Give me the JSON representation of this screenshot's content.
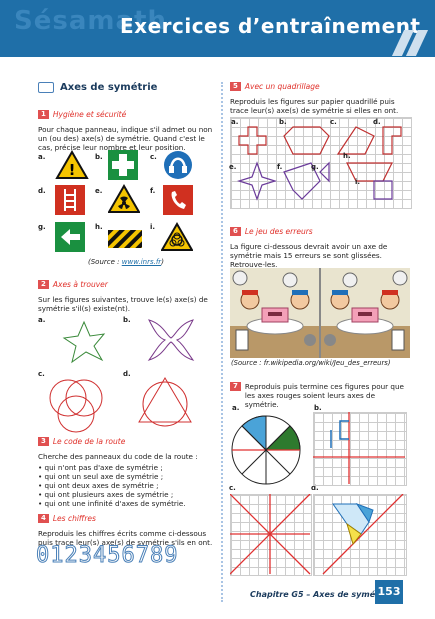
{
  "banner": {
    "ghost": "Sésamath",
    "title": "Exercices d’entraînement"
  },
  "section": {
    "title": "Axes de symétrie"
  },
  "ex1": {
    "num": "1",
    "title": "Hygiène et sécurité",
    "text": "Pour chaque panneau, indique s'il admet ou non un (ou des) axe(s) de symétrie. Quand c'est le cas, précise leur nombre et leur position.",
    "labels": [
      "a.",
      "b.",
      "c.",
      "d.",
      "e.",
      "f.",
      "g.",
      "h.",
      "i."
    ],
    "source_prefix": "(Source : ",
    "source_link": "www.inrs.fr",
    "source_suffix": ")"
  },
  "ex2": {
    "num": "2",
    "title": "Axes à trouver",
    "text": "Sur les figures suivantes, trouve le(s) axe(s) de symétrie s'il(s) existe(nt).",
    "labels": [
      "a.",
      "b.",
      "c.",
      "d."
    ]
  },
  "ex3": {
    "num": "3",
    "title": "Le code de la route",
    "intro": "Cherche des panneaux du code de la route :",
    "items": [
      "• qui n'ont pas d'axe de symétrie ;",
      "• qui ont un seul axe de symétrie ;",
      "• qui ont deux axes de symétrie ;",
      "• qui ont plusieurs axes de symétrie ;",
      "• qui ont une infinité d'axes de symétrie."
    ]
  },
  "ex4": {
    "num": "4",
    "title": "Les chiffres",
    "text": "Reproduis les chiffres écrits comme ci-dessous puis trace leur(s) axe(s) de symétrie s'ils en ont.",
    "digits": "0123456789"
  },
  "ex5": {
    "num": "5",
    "title": "Avec un quadrillage",
    "text": "Reproduis les figures sur papier quadrillé puis trace leur(s) axe(s) de symétrie si elles en ont.",
    "labels": [
      "a.",
      "b.",
      "c.",
      "d.",
      "e.",
      "f.",
      "g.",
      "h.",
      "i."
    ]
  },
  "ex6": {
    "num": "6",
    "title": "Le jeu des erreurs",
    "text": "La figure ci-dessous devrait avoir un axe de symétrie mais 15 erreurs se sont glissées. Retrouve-les.",
    "source": "(Source : fr.wikipedia.org/wiki/Jeu_des_erreurs)"
  },
  "ex7": {
    "num": "7",
    "text": "Reproduis puis termine ces figures pour que les axes rouges soient leurs axes de symétrie.",
    "labels": [
      "a.",
      "b.",
      "c.",
      "d."
    ]
  },
  "footer": {
    "chapter": "Chapitre G5 – Axes de symétrie",
    "page": "153"
  },
  "colors": {
    "banner": "#1f6fa8",
    "accent_red": "#e0302a",
    "axis_red": "#e03030"
  }
}
